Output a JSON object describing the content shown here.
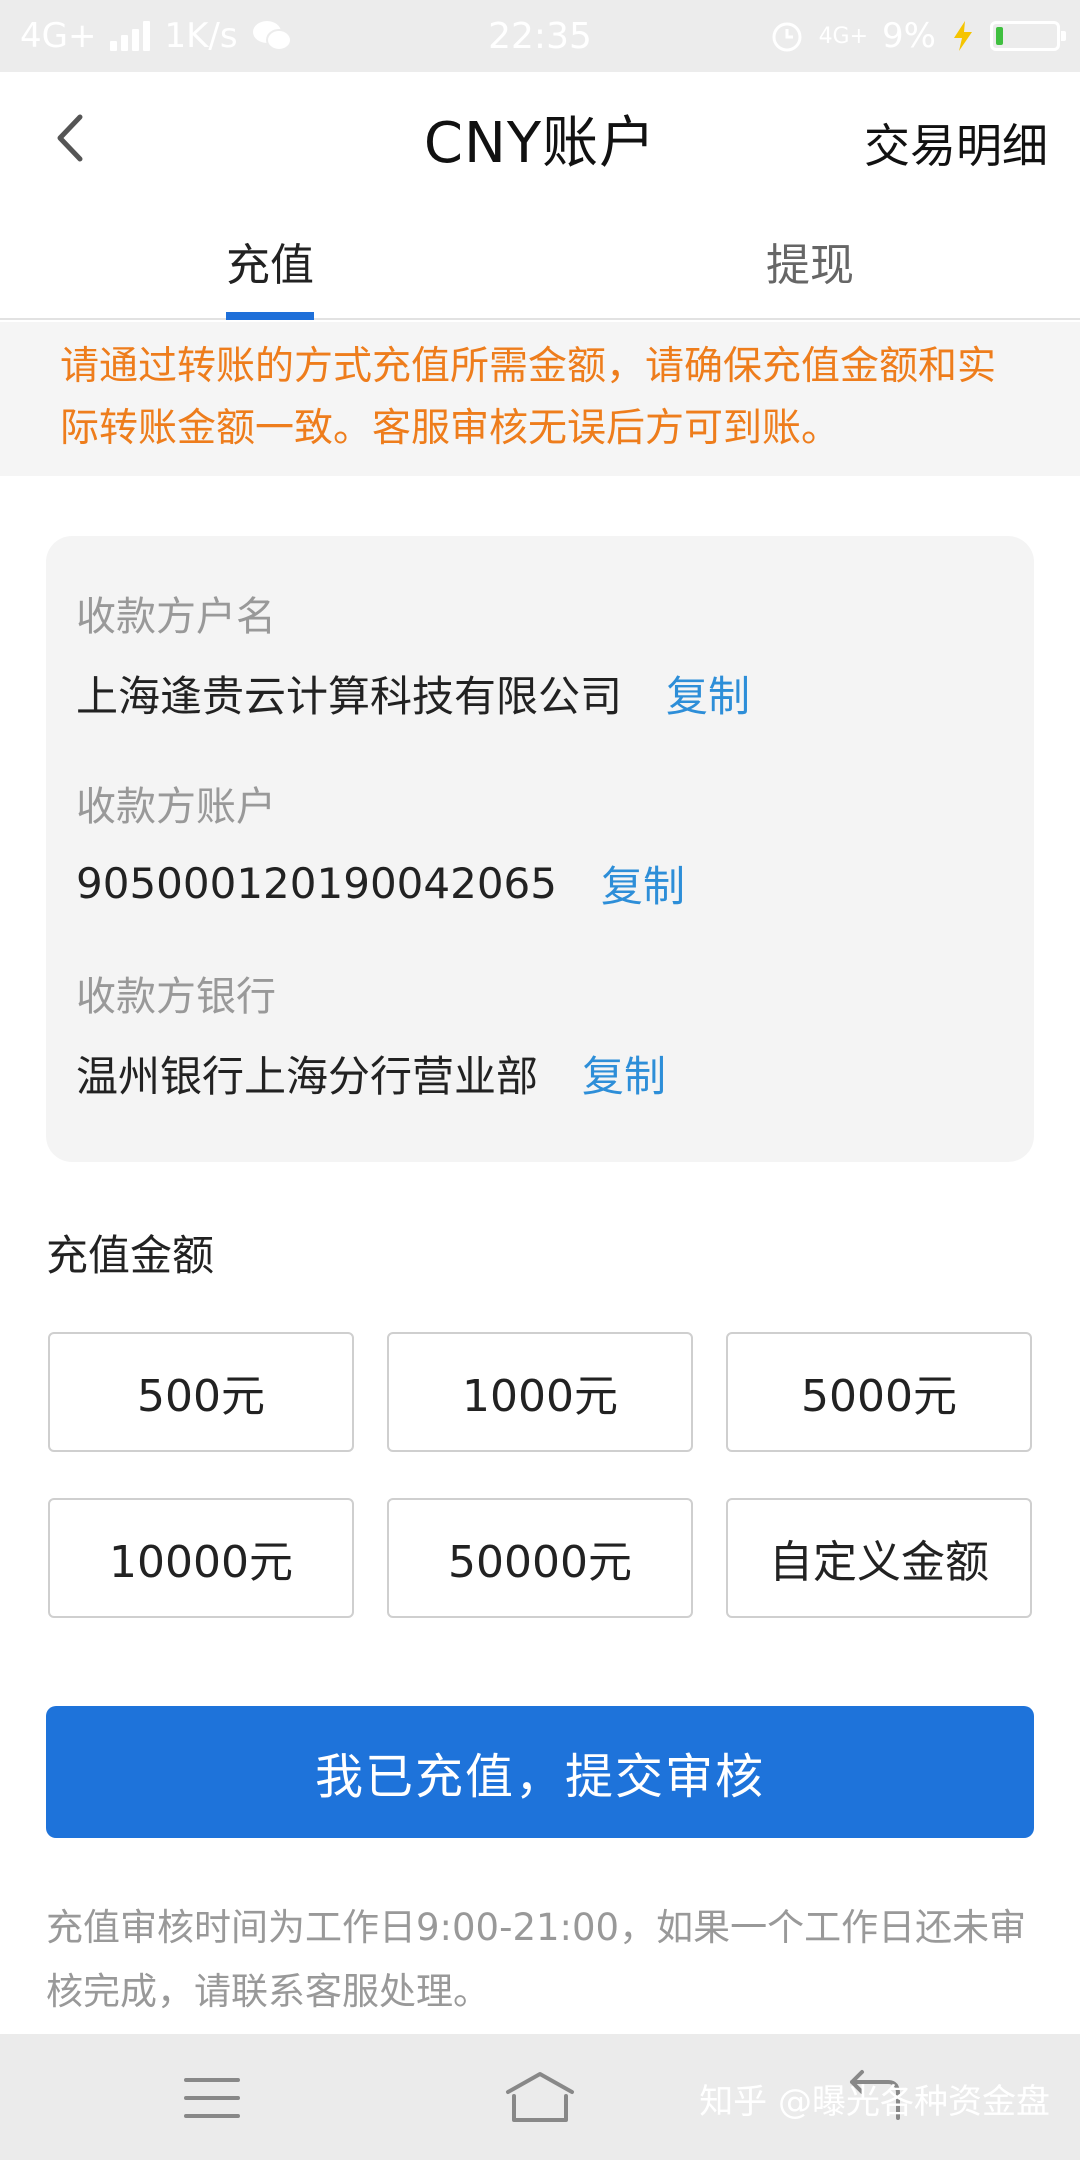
{
  "status_bar": {
    "network": "4G+",
    "speed": "1K/s",
    "time": "22:35",
    "network_right": "4G+",
    "battery": "9%"
  },
  "header": {
    "title": "CNY账户",
    "action": "交易明细"
  },
  "tabs": [
    {
      "label": "充值",
      "active": true
    },
    {
      "label": "提现",
      "active": false
    }
  ],
  "notice": "请通过转账的方式充值所需金额，请确保充值金额和实际转账金额一致。客服审核无误后方可到账。",
  "info": {
    "copy_label": "复制",
    "items": [
      {
        "label": "收款方户名",
        "value": "上海逢贵云计算科技有限公司"
      },
      {
        "label": "收款方账户",
        "value": "9050001201900420​65"
      },
      {
        "label": "收款方银行",
        "value": "温州银行上海分行营业部"
      }
    ]
  },
  "amount": {
    "title": "充值金额",
    "options": [
      "500元",
      "1000元",
      "5000元",
      "10000元",
      "50000元",
      "自定义金额"
    ]
  },
  "submit_label": "我已充值，提交审核",
  "footnote": "充值审核时间为工作日9:00-21:00，如果一个工作日还未审核完成，请联系客服处理。",
  "watermark": "知乎 @曝光各种资金盘",
  "colors": {
    "accent": "#1e73da",
    "notice": "#ee7d1c",
    "link": "#2d8ed8"
  }
}
